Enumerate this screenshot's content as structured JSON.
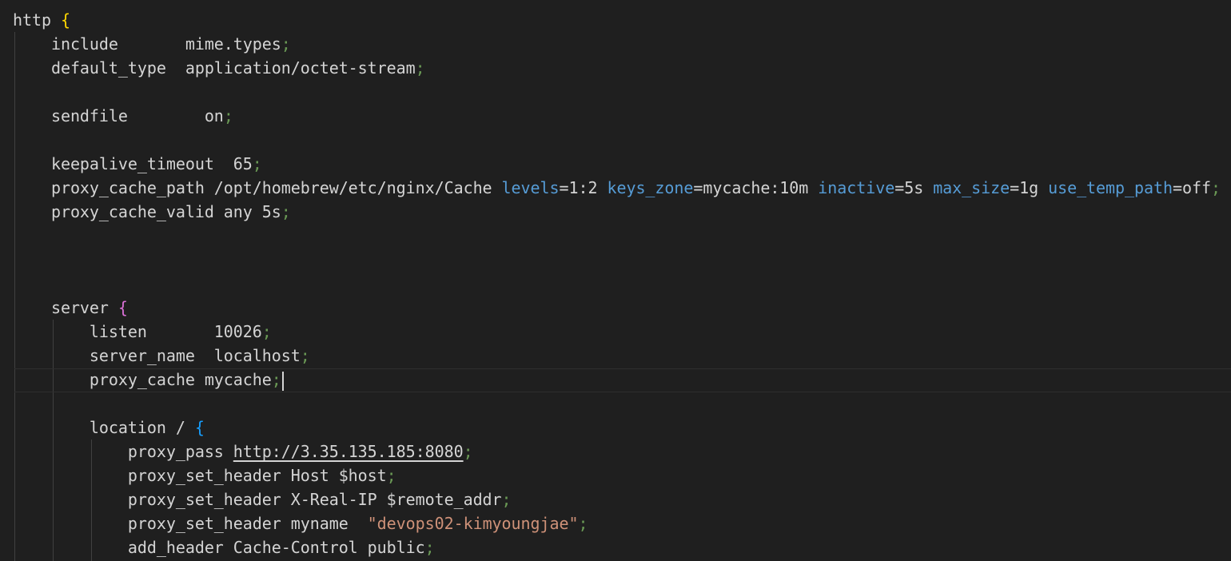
{
  "editor": {
    "language": "nginx",
    "colors": {
      "background": "#1f1f1f",
      "text": "#d4d4d4",
      "attribute": "#569cd6",
      "semicolon": "#6a9955",
      "brace_level1": "#ffd700",
      "brace_level2": "#da70d6",
      "brace_level3": "#179fff",
      "string": "#ce9178"
    },
    "lines": {
      "l1": {
        "code": "http ",
        "brace": "{"
      },
      "l2": {
        "code": "    include       mime.types",
        "semi": ";"
      },
      "l3": {
        "code": "    default_type  application/octet-stream",
        "semi": ";"
      },
      "l4": {
        "code": "    sendfile        on",
        "semi": ";"
      },
      "l5": {
        "code": "    keepalive_timeout  65",
        "semi": ";"
      },
      "l6": {
        "code_a": "    proxy_cache_path /opt/homebrew/etc/nginx/Cache ",
        "attr1": "levels",
        "val1": "=1:2 ",
        "attr2": "keys_zone",
        "val2": "=mycache:10m ",
        "attr3": "inactive",
        "val3": "=5s ",
        "attr4": "max_size",
        "val4": "=1g ",
        "attr5": "use_temp_path",
        "val5": "=off",
        "semi": ";"
      },
      "l7": {
        "code": "    proxy_cache_valid any 5s",
        "semi": ";"
      },
      "l8": {
        "code": "    server ",
        "brace": "{"
      },
      "l9": {
        "code": "        listen       10026",
        "semi": ";"
      },
      "l10": {
        "code": "        server_name  localhost",
        "semi": ";"
      },
      "l11": {
        "code": "        proxy_cache mycache",
        "semi": ";"
      },
      "l12": {
        "code": "        location / ",
        "brace": "{"
      },
      "l13": {
        "code": "            proxy_pass ",
        "url": "http://3.35.135.185:8080",
        "semi": ";"
      },
      "l14": {
        "code": "            proxy_set_header Host $host",
        "semi": ";"
      },
      "l15": {
        "code": "            proxy_set_header X-Real-IP $remote_addr",
        "semi": ";"
      },
      "l16": {
        "code": "            proxy_set_header myname  ",
        "str": "\"devops02-kimyoungjae\"",
        "semi": ";"
      },
      "l17": {
        "code": "            add_header Cache-Control public",
        "semi": ";"
      }
    }
  }
}
